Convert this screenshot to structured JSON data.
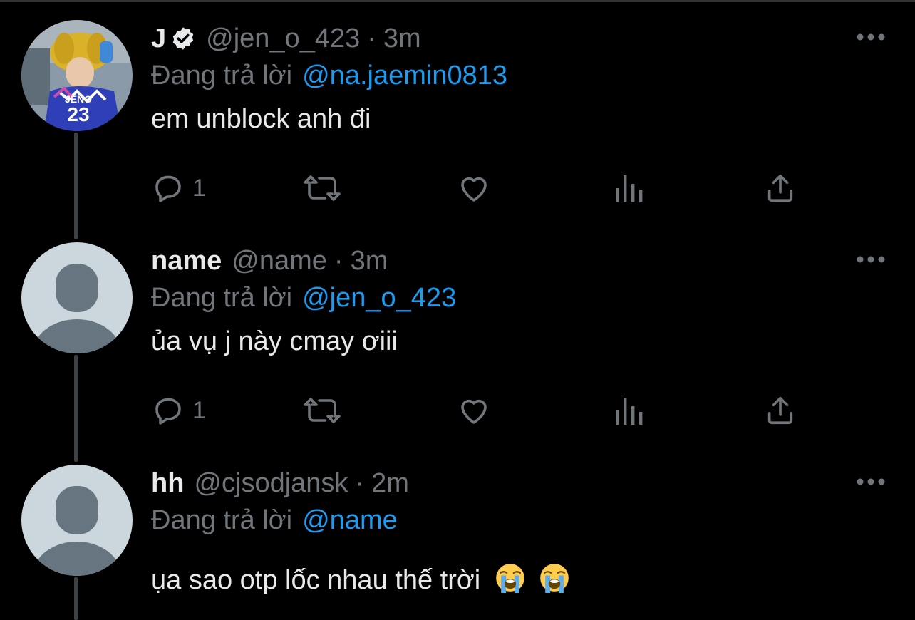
{
  "colors": {
    "background": "#000000",
    "text_primary": "#e7e9ea",
    "text_secondary": "#71767b",
    "accent": "#1d9bf0",
    "thread_line": "#3d4247"
  },
  "reply_prefix": "Đang trả lời",
  "tweets": [
    {
      "display_name": "J",
      "verified": true,
      "handle": "@jen_o_423",
      "separator": "·",
      "time": "3m",
      "replying_to": "@na.jaemin0813",
      "text": "em unblock anh đi",
      "reply_count": "1",
      "avatar": "photo-avatar-icon"
    },
    {
      "display_name": "name",
      "verified": false,
      "handle": "@name",
      "separator": "·",
      "time": "3m",
      "replying_to": "@jen_o_423",
      "text": "ủa vụ j này cmay ơiii",
      "reply_count": "1",
      "avatar": "default-avatar-icon"
    },
    {
      "display_name": "hh",
      "verified": false,
      "handle": "@cjsodjansk",
      "separator": "·",
      "time": "2m",
      "replying_to": "@name",
      "text": "ụa sao otp lốc nhau thế trời",
      "emojis": [
        "loudly-crying-face-icon",
        "loudly-crying-face-icon"
      ],
      "avatar": "default-avatar-icon"
    }
  ]
}
